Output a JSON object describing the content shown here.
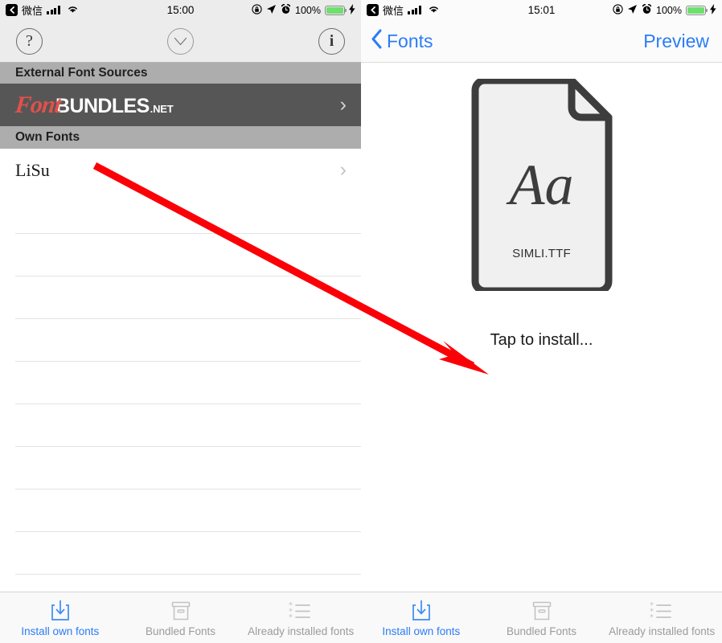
{
  "left_panel": {
    "status_bar": {
      "back_icon": "back-arrow-icon",
      "carrier": "微信",
      "signal_icon": "signal-bars-icon",
      "wifi_icon": "wifi-icon",
      "time": "15:00",
      "rotation_lock_icon": "rotation-lock-icon",
      "location_icon": "location-arrow-icon",
      "alarm_icon": "alarm-clock-icon",
      "battery_percent": "100%",
      "battery_icon": "battery-full-icon",
      "charging_icon": "lightning-bolt-icon"
    },
    "toolbar": {
      "help_label": "?",
      "check_icon": "checkmark-circle-icon",
      "info_label": "i"
    },
    "sections": [
      {
        "header": "External Font Sources",
        "promo": {
          "logo_font": "Font",
          "logo_bundles": "BUNDLES",
          "logo_net": ".NET",
          "chevron": "›"
        }
      },
      {
        "header": "Own Fonts",
        "fonts": [
          {
            "name": "LiSu",
            "chevron": "›"
          }
        ],
        "empty_row_count": 10
      }
    ]
  },
  "right_panel": {
    "status_bar": {
      "back_icon": "back-arrow-icon",
      "carrier": "微信",
      "signal_icon": "signal-bars-icon",
      "wifi_icon": "wifi-icon",
      "time": "15:01",
      "rotation_lock_icon": "rotation-lock-icon",
      "location_icon": "location-arrow-icon",
      "alarm_icon": "alarm-clock-icon",
      "battery_percent": "100%",
      "battery_icon": "battery-full-icon",
      "charging_icon": "lightning-bolt-icon"
    },
    "nav_bar": {
      "back_label": "Fonts",
      "back_icon": "chevron-left-icon",
      "right_action": "Preview"
    },
    "document": {
      "preview_glyphs": "Aa",
      "file_name": "SIMLI.TTF",
      "caption": "Tap to install..."
    }
  },
  "tab_bar": {
    "tabs": [
      {
        "label": "Install own fonts",
        "icon": "download-box-icon",
        "active": true
      },
      {
        "label": "Bundled Fonts",
        "icon": "archive-box-icon",
        "active": false
      },
      {
        "label": "Already installed fonts",
        "icon": "starred-list-icon",
        "active": false
      }
    ]
  },
  "annotation": {
    "arrow_color": "#fb0007",
    "arrow_from": "LiSu row",
    "arrow_to": "Tap to install caption"
  },
  "colors": {
    "accent_blue": "#2b7cf6",
    "section_header_gray": "#adadad",
    "promo_dark": "#565656",
    "logo_red": "#e0514b",
    "annotation_red": "#fb0007",
    "inactive_tab_gray": "#9b9b9b"
  }
}
